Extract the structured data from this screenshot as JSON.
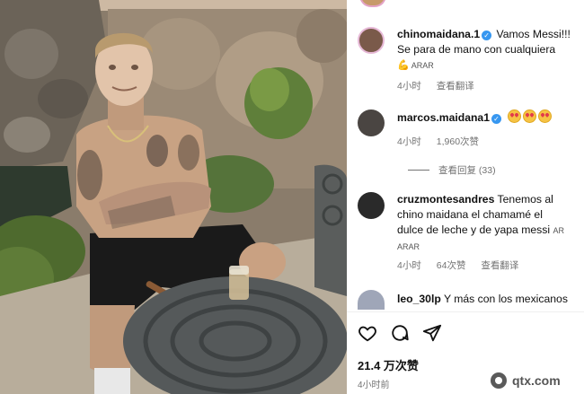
{
  "post": {
    "likes": "21.4 万次赞",
    "time": "4小时前"
  },
  "comments": [
    {
      "user": "chinomaidana.1",
      "line1": "Vamos Messi!!!",
      "line2": "Se para de mano con cualquiera",
      "translate_tag": "ARAR",
      "time": "4小时",
      "translate": "查看翻译"
    },
    {
      "user": "marcos.maidana1",
      "time": "4小时",
      "likes": "1,960次赞",
      "replies": "查看回复 (33)"
    },
    {
      "user": "cruzmontesandres",
      "line1": "Tenemos al",
      "line2": "chino maidana el chamamé el",
      "line3": "dulce de leche y de yapa messi",
      "tag_inline": "AR",
      "tag_line": "ARAR",
      "time": "4小时",
      "likes": "64次赞",
      "translate": "查看翻译"
    },
    {
      "user": "leo_30lp",
      "text": "Y más con los mexicanos"
    }
  ],
  "watermark": "qtx.com",
  "colors": {
    "verified": "#3797f0",
    "meta": "#737373"
  },
  "icons": [
    "heart-icon",
    "comment-icon",
    "share-icon",
    "verified-icon",
    "heart-eyes-emoji",
    "flexed-bicep-emoji"
  ]
}
